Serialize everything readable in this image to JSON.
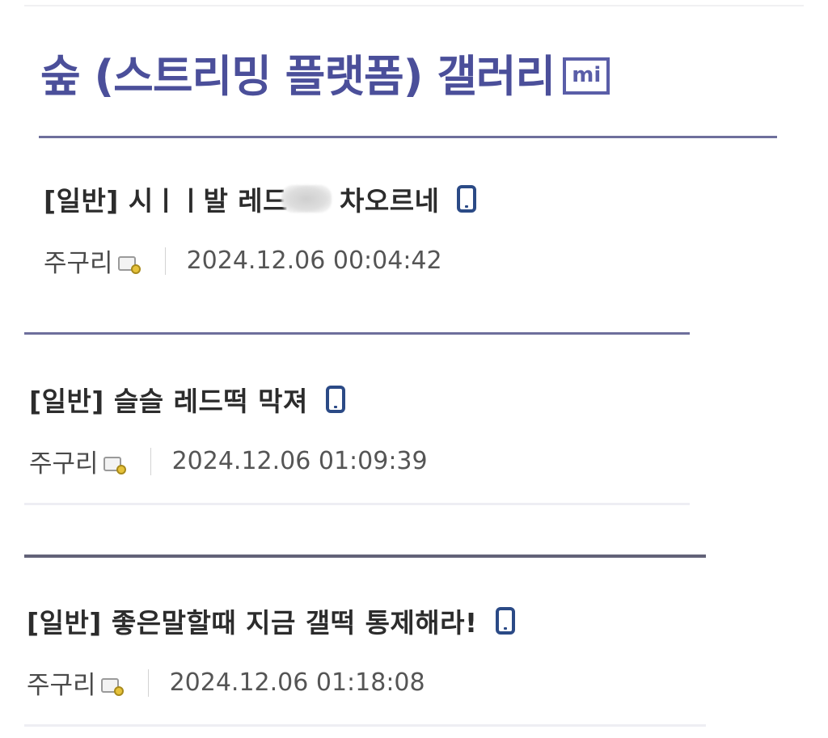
{
  "gallery": {
    "title": "숲 (스트리밍 플랫폼) 갤러리",
    "badge": "mi"
  },
  "posts": [
    {
      "title_before": "[일반] 시ㅣㅣ발 레드",
      "title_after": "차오르네",
      "author": "주구리",
      "date": "2024.12.06 00:04:42"
    },
    {
      "title": "[일반] 슬슬 레드떡 막져",
      "author": "주구리",
      "date": "2024.12.06 01:09:39"
    },
    {
      "title": "[일반] 좋은말할때 지금 갤떡 통제해라!",
      "author": "주구리",
      "date": "2024.12.06 01:18:08"
    }
  ],
  "icons": {
    "mobile": "mobile-phone-icon",
    "fixed_nick": "fixed-nickname-icon"
  },
  "colors": {
    "title": "#4b4f9a",
    "rule": "#6e6f9c",
    "mobile_icon": "#2b4a86"
  }
}
